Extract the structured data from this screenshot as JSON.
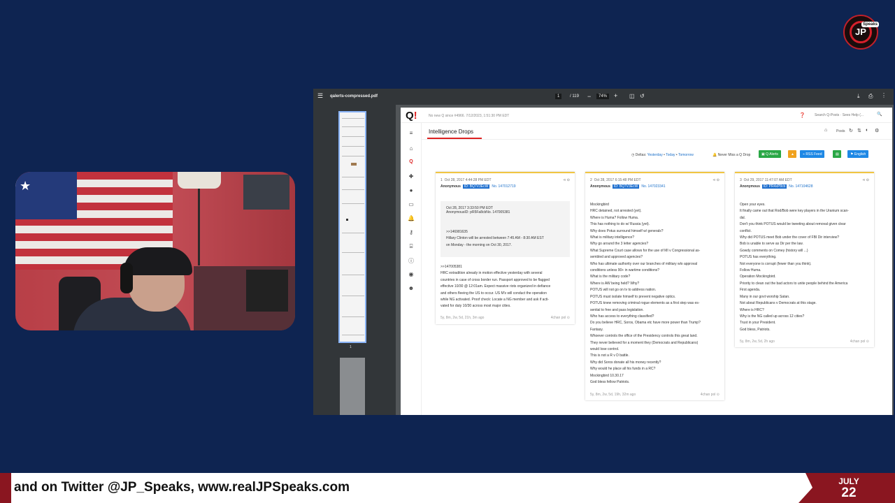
{
  "overlay": {
    "logo_text": "JP",
    "logo_tag": "Speaks"
  },
  "viewer": {
    "file_name": "qalerts-compressed.pdf",
    "page_current": "1",
    "page_total": "/ 119",
    "zoom": "74%",
    "thumb_page_label": "1"
  },
  "site": {
    "notice": "No new Q since #4966. 7/12/2023, 1:51:30 PM EDT",
    "search_placeholder": "Search Q-Posts · Sees Help (...",
    "section_title": "Intelligence Drops",
    "posts_label": "Posts",
    "deltas_label": "Deltas:",
    "deltas_links": [
      "Yesterday",
      "Today",
      "Tomorrow"
    ],
    "never_miss": "Never Miss a Q Drop",
    "buttons": {
      "q_alerts": "Q Alerts",
      "rss": "RSS Feed",
      "english": "English"
    }
  },
  "posts": [
    {
      "num": "1",
      "date": "Oct 28, 2017 4:44:28 PM EDT",
      "author": "Anonymous",
      "id": "ID: BQ7V3EcW",
      "no": "No. 147012719",
      "quote": {
        "date": "Oct 28, 2017 3:33:50 PM EDT",
        "author": "Anonymous",
        "id": "ID: pR5Fa8cb",
        "no": "No. 147005381",
        "lines": [
          ">>146981635",
          "Hillary Clinton will be arrested between 7:45 AM - 8:30 AM EST",
          "on Monday - the morning on Oct 30, 2017."
        ]
      },
      "lines": [
        ">>147005381",
        "HRC extradition already in motion effective yesterday with several",
        "countries in case of cross border run. Passport approved to be flagged",
        "effective 10/30 @ 12:01am. Expect massive riots organized in defiance",
        "and others fleeing the US to occur. US M's will conduct the operation",
        "while NG activated. Proof check: Locate a NG member and ask if acti-",
        "vated for duty 10/30 across most major cities."
      ],
      "age": "5y, 8m, 2w, 5d, 21h, 3m ago",
      "source": "4chan pol"
    },
    {
      "num": "2",
      "date": "Oct 28, 2017 6:15:48 PM EDT",
      "author": "Anonymous",
      "id": "ID: BQ7V3EcW",
      "no": "No. 147023341",
      "lines": [
        "Mockingbird",
        "HRC detained, not arrested (yet).",
        "Where is Huma? Follow Huma.",
        "This has nothing to do w/ Russia (yet).",
        "Why does Potus surround himself w/ generals?",
        "What is military intelligence?",
        "Why go around the 3 letter agencies?",
        "What Supreme Court case allows for the use of MI v Congressional as-",
        "sembled and approved agencies?",
        "Who has ultimate authority over our branches of military wlo approval",
        "conditions unless 90+ in wartime conditions?",
        "What is the military code?",
        "Where is AW being held? Why?",
        "POTUS will not go on tv to address nation.",
        "POTUS must isolate himself to prevent negative optics.",
        "POTUS knew removing criminal rogue elements as a first step was es-",
        "sential to free and pass legislation.",
        "Who has access to everything classified?",
        "Do you believe HRC, Soros, Obama etc have more power than Trump?",
        "Fantasy.",
        "Whoever controls the office of the Presidency controls this great land.",
        "They never believed for a moment they (Democrats and Republicans)",
        "would lose control.",
        "This is not a R v D battle.",
        "Why did Soros donate all his money recently?",
        "Why would he place all his funds in a RC?",
        "Mockingbird 10.30.17",
        "God bless fellow Patriots."
      ],
      "age": "5y, 8m, 2w, 5d, 19h, 32m ago",
      "source": "4chan pol"
    },
    {
      "num": "3",
      "date": "Oct 29, 2017 11:47:07 AM EDT",
      "author": "Anonymous",
      "id": "ID: PR4xP8cb",
      "no": "No. 147104628",
      "lines": [
        "Open your eyes.",
        "It finally came out that Rod/Bob were key players in the Uranium scan-",
        "dal.",
        "Don't you think POTUS would be tweeting about removal given clear",
        "conflict.",
        "Why did POTUS meet Bob under the cover of FBI Dir interview?",
        "Bob is unable to serve as Dir per the law.",
        "Gowdy comments on Comey (history will ...)",
        "POTUS has everything.",
        "Not everyone is corrupt (fewer than you think).",
        "Follow Huma.",
        "Operation Mockingbird.",
        "Priority to clean out the bad actors to unite people behind the America",
        "First agenda.",
        "Many in our govt worship Satan.",
        "Not about Republicans v Democrats at this stage.",
        "Where is HRC?",
        "Why is the NG called up across 12 cities?",
        "Trust in your President.",
        "God bless, Patriots."
      ],
      "age": "5y, 8m, 2w, 5d, 2h ago",
      "source": "4chan pol"
    }
  ],
  "ticker": {
    "text": "and on Twitter @JP_Speaks, www.realJPSpeaks.com",
    "month": "JULY",
    "day": "22"
  },
  "colors": {
    "background": "#0e2451",
    "accent_red": "#8a1620",
    "q_red": "#dd2222",
    "link_blue": "#1a6fc9"
  }
}
